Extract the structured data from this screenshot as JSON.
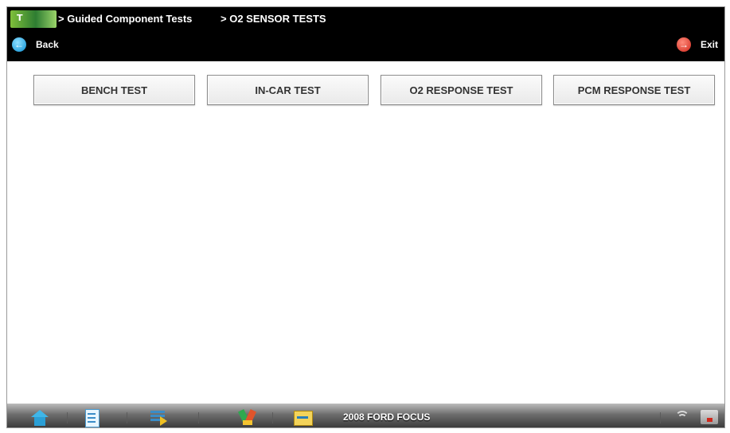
{
  "header": {
    "logo_text": "T",
    "breadcrumbs": [
      "> Guided Component Tests",
      "> O2 SENSOR TESTS"
    ],
    "back_label": "Back",
    "exit_label": "Exit"
  },
  "tests": {
    "buttons": [
      "BENCH TEST",
      "IN-CAR TEST",
      "O2 RESPONSE TEST",
      "PCM RESPONSE TEST"
    ]
  },
  "toolbar": {
    "vehicle": "2008 FORD FOCUS",
    "icons": [
      "home-icon",
      "document-icon",
      "list-icon",
      "tools-icon",
      "scope-icon",
      "wifi-icon",
      "battery-icon"
    ]
  },
  "colors": {
    "header_bg": "#000000",
    "back_accent": "#0a8fd4",
    "exit_accent": "#d0281c"
  }
}
